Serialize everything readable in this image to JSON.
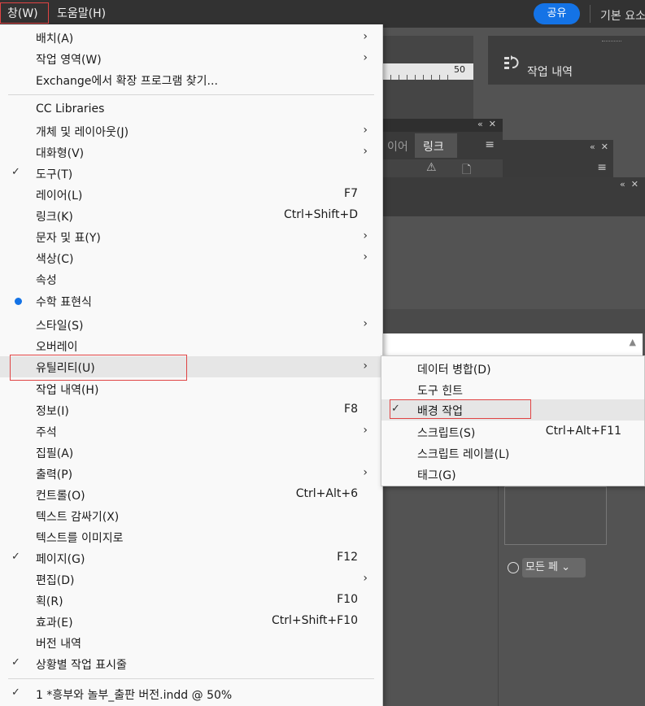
{
  "topbar": {
    "window_menu": "창(W)",
    "help_menu": "도움말(H)",
    "share": "공유",
    "workspace": "기본 요소"
  },
  "panels": {
    "ruler_number": "50",
    "history_label": "작업 내역",
    "link_tab_partial": "이어",
    "link_tab": "링크",
    "radio_select": "모든 페"
  },
  "menu": {
    "items": [
      {
        "label": "배치(A)",
        "submenu": true
      },
      {
        "label": "작업 영역(W)",
        "submenu": true
      },
      {
        "label": "Exchange에서 확장 프로그램 찾기..."
      },
      {
        "label": "CC Libraries"
      },
      {
        "label": "개체 및 레이아웃(J)",
        "submenu": true
      },
      {
        "label": "대화형(V)",
        "submenu": true
      },
      {
        "label": "도구(T)",
        "checked": true
      },
      {
        "label": "레이어(L)",
        "shortcut": "F7"
      },
      {
        "label": "링크(K)",
        "shortcut": "Ctrl+Shift+D"
      },
      {
        "label": "문자 및 표(Y)",
        "submenu": true
      },
      {
        "label": "색상(C)",
        "submenu": true
      },
      {
        "label": "속성"
      },
      {
        "label": "수학 표현식",
        "dot": true
      },
      {
        "label": "스타일(S)",
        "submenu": true
      },
      {
        "label": "오버레이"
      },
      {
        "label": "유틸리티(U)",
        "submenu": true,
        "highlighted": true
      },
      {
        "label": "작업 내역(H)"
      },
      {
        "label": "정보(I)",
        "shortcut": "F8"
      },
      {
        "label": "주석",
        "submenu": true
      },
      {
        "label": "집필(A)"
      },
      {
        "label": "출력(P)",
        "submenu": true
      },
      {
        "label": "컨트롤(O)",
        "shortcut": "Ctrl+Alt+6"
      },
      {
        "label": "텍스트 감싸기(X)"
      },
      {
        "label": "텍스트를 이미지로"
      },
      {
        "label": "페이지(G)",
        "shortcut": "F12",
        "checked": true
      },
      {
        "label": "편집(D)",
        "submenu": true
      },
      {
        "label": "획(R)",
        "shortcut": "F10"
      },
      {
        "label": "효과(E)",
        "shortcut": "Ctrl+Shift+F10"
      },
      {
        "label": "버전 내역"
      },
      {
        "label": "상황별 작업 표시줄",
        "checked": true
      },
      {
        "label": "1 *흥부와 놀부_출판 버전.indd @ 50%",
        "checked": true
      }
    ]
  },
  "submenu": {
    "items": [
      {
        "label": "데이터 병합(D)"
      },
      {
        "label": "도구 힌트"
      },
      {
        "label": "배경 작업",
        "checked": true,
        "highlighted": true
      },
      {
        "label": "스크립트(S)",
        "shortcut": "Ctrl+Alt+F11"
      },
      {
        "label": "스크립트 레이블(L)"
      },
      {
        "label": "태그(G)"
      }
    ]
  },
  "glyphs": {
    "submenu_arrow": "›",
    "check": "✓",
    "menu_lines": "≡",
    "double_chevron": "«",
    "close": "✕",
    "chevron_down": "⌄",
    "scroll_up": "▲",
    "warning": "⚠",
    "page": "🗋"
  },
  "icons": {
    "history_icon": "history-icon",
    "dot_color": "#1473e6",
    "highlight_border": "#e04444"
  }
}
